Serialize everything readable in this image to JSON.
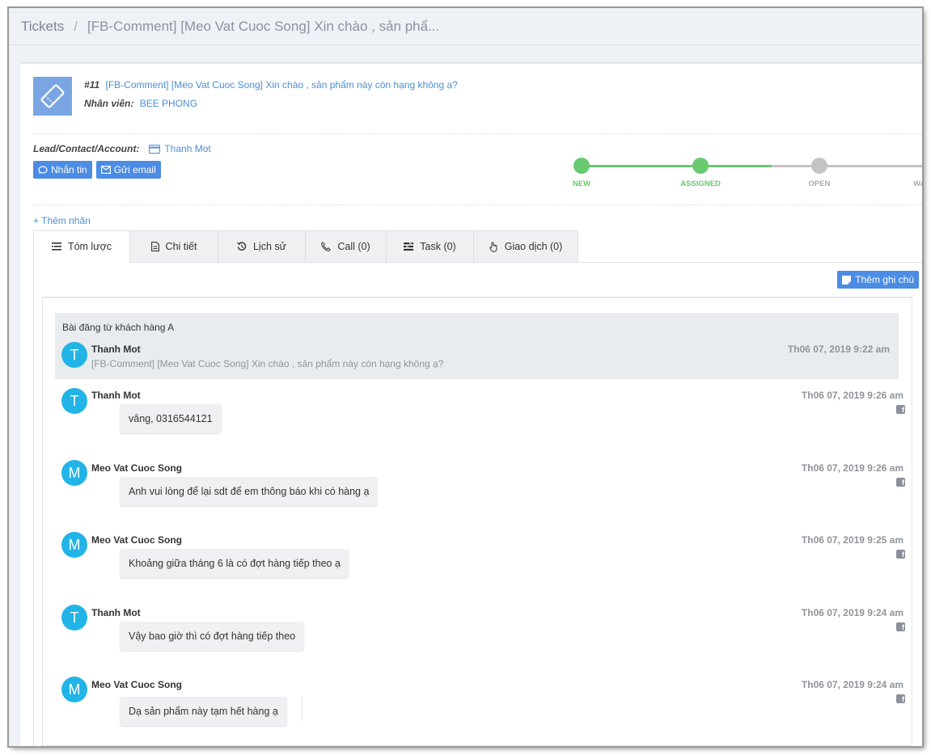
{
  "breadcrumb": {
    "root": "Tickets",
    "separator": "/",
    "current": "[FB-Comment] [Meo Vat Cuoc Song] Xin chào , sản phẩ..."
  },
  "ticket": {
    "number": "#11",
    "title": "[FB-Comment] [Meo Vat Cuoc Song] Xin chào , sản phẩm này còn hạng không ạ?",
    "staff_label": "Nhân viên:",
    "staff_value": "BEE PHONG",
    "lead_label": "Lead/Contact/Account:",
    "lead_value": "Thanh Mot"
  },
  "actions": {
    "message_label": "Nhắn tin",
    "email_label": "Gửi email",
    "add_tag_label": "+ Thêm nhãn",
    "add_note_label": "Thêm ghi chú"
  },
  "status_steps": [
    {
      "label": "NEW",
      "done": true
    },
    {
      "label": "ASSIGNED",
      "done": true
    },
    {
      "label": "OPEN",
      "done": false
    },
    {
      "label": "WAIT",
      "done": false
    }
  ],
  "tabs": [
    {
      "label": "Tóm lược",
      "icon": "list-icon"
    },
    {
      "label": "Chi tiết",
      "icon": "document-icon"
    },
    {
      "label": "Lịch sử",
      "icon": "history-icon"
    },
    {
      "label": "Call (0)",
      "icon": "phone-icon"
    },
    {
      "label": "Task (0)",
      "icon": "tasks-icon"
    },
    {
      "label": "Giao dịch (0)",
      "icon": "hand-icon"
    }
  ],
  "post": {
    "heading": "Bài đăng từ khách hàng A",
    "initial": "T",
    "author": "Thanh Mot",
    "text": "[FB-Comment] [Meo Vat Cuoc Song] Xin chào , sản phẩm này còn hạng không ạ?",
    "time": "Th06 07, 2019 9:22 am"
  },
  "messages": [
    {
      "initial": "T",
      "author": "Thanh Mot",
      "text": "vâng, 0316544121",
      "time": "Th06 07, 2019 9:26 am",
      "source": "f"
    },
    {
      "initial": "M",
      "author": "Meo Vat Cuoc Song",
      "text": "Anh vui lòng để lại sdt để em thông báo khi có hàng ạ",
      "time": "Th06 07, 2019 9:26 am",
      "source": "f"
    },
    {
      "initial": "M",
      "author": "Meo Vat Cuoc Song",
      "text": "Khoảng giữa tháng 6 là có đợt hàng tiếp theo ạ",
      "time": "Th06 07, 2019 9:25 am",
      "source": "f"
    },
    {
      "initial": "T",
      "author": "Thanh Mot",
      "text": "Vậy bao giờ thì có đợt hàng tiếp theo",
      "time": "Th06 07, 2019 9:24 am",
      "source": "f"
    },
    {
      "initial": "M",
      "author": "Meo Vat Cuoc Song",
      "text": "Dạ sản phẩm này tạm hết hàng ạ",
      "time": "Th06 07, 2019 9:24 am",
      "source": "f"
    }
  ],
  "colors": {
    "accent": "#4b8ce4",
    "step_done": "#69c96e",
    "step_todo": "#c4c4c4",
    "avatar": "#22b4e6"
  }
}
